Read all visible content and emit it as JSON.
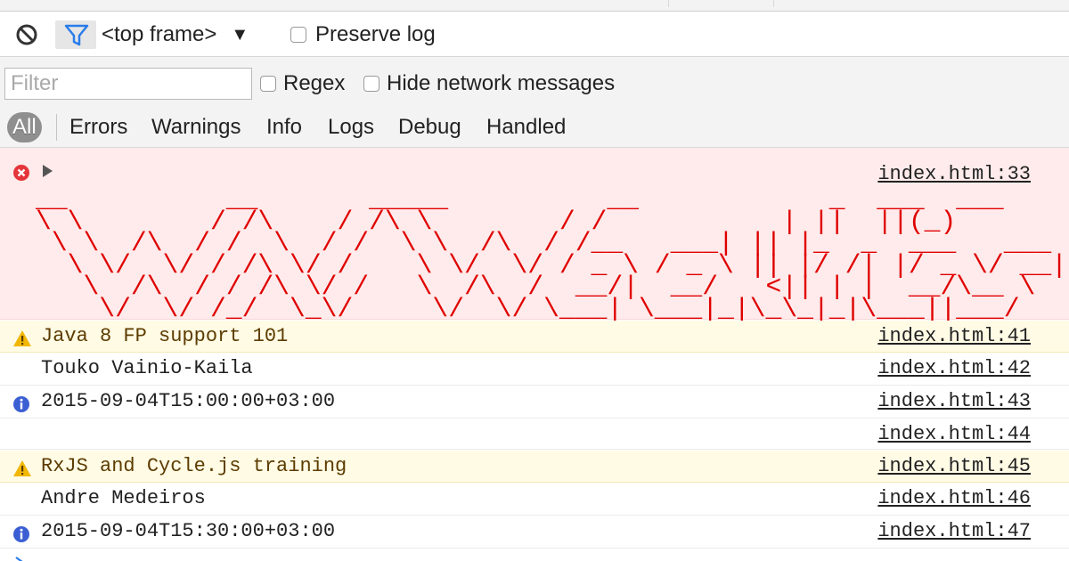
{
  "toolbar": {
    "context": "<top frame>",
    "preserve_log_label": "Preserve log"
  },
  "filterbar": {
    "filter_placeholder": "Filter",
    "regex_label": "Regex",
    "hide_network_label": "Hide network messages",
    "levels": [
      "All",
      "Errors",
      "Warnings",
      "Info",
      "Logs",
      "Debug",
      "Handled"
    ],
    "active_level": "All"
  },
  "console": {
    "messages": [
      {
        "level": "error",
        "icon": "error-icon",
        "text": "",
        "source": "index.html:33",
        "ascii_art": "__          __       _____          __            _  ___  ___\n\\ \\        / /\\    / /\\ \\        / /           | ||  ||(_)\n \\ \\  /\\  / /  \\  / /  \\ \\  /\\  / /__   ___| || |_  _  ___   ___\n  \\ \\/  \\/ / /\\ \\/ /    \\ \\/  \\/ / _ \\ / _ \\ || |/ /| |/ _ \\/ __|\n   \\  /\\  / / /\\ \\/ /   \\  /\\  /  __/|  __/   <|| | |  __/\\__ \\\n    \\/  \\/ /_/  \\_\\/     \\/  \\/ \\___| \\___|_|\\_\\_|_|\\___||___/"
      },
      {
        "level": "warning",
        "icon": "warning-icon",
        "text": "Java 8 FP support 101",
        "source": "index.html:41"
      },
      {
        "level": "log",
        "icon": "",
        "text": "Touko Vainio-Kaila",
        "source": "index.html:42"
      },
      {
        "level": "info",
        "icon": "info-icon",
        "text": "2015-09-04T15:00:00+03:00",
        "source": "index.html:43"
      },
      {
        "level": "log",
        "icon": "",
        "text": "",
        "source": "index.html:44"
      },
      {
        "level": "warning",
        "icon": "warning-icon",
        "text": "RxJS and Cycle.js training",
        "source": "index.html:45"
      },
      {
        "level": "log",
        "icon": "",
        "text": "Andre Medeiros",
        "source": "index.html:46"
      },
      {
        "level": "info",
        "icon": "info-icon",
        "text": "2015-09-04T15:30:00+03:00",
        "source": "index.html:47"
      }
    ]
  },
  "colors": {
    "error_bg": "#ffebeb",
    "warning_bg": "#fffbe5",
    "error_red": "#e00000",
    "info_blue": "#3b5fd3",
    "warning_yellow": "#f2b705",
    "filter_blue": "#2b7de9"
  }
}
